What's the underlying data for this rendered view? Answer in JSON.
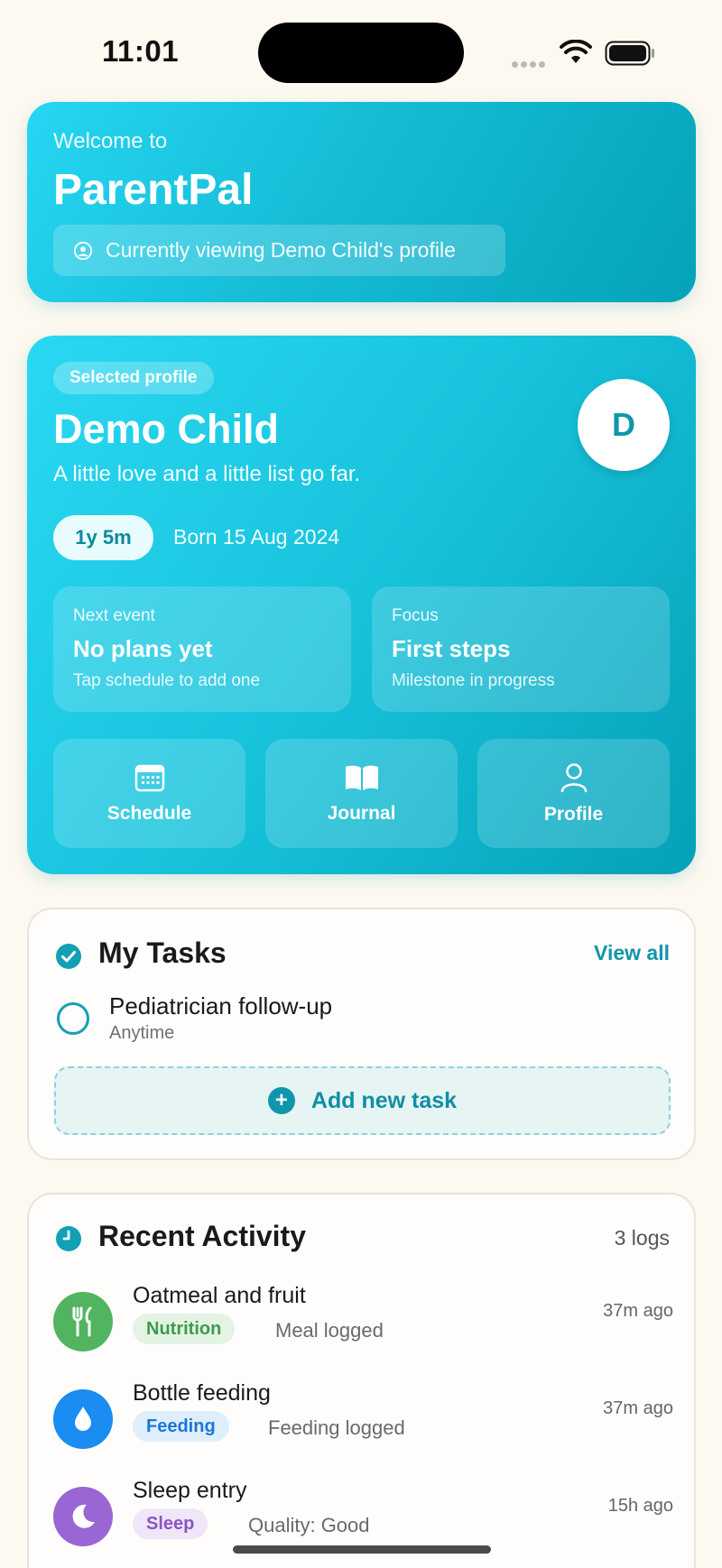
{
  "status_bar": {
    "time": "11:01"
  },
  "welcome": {
    "subtitle": "Welcome to",
    "app_name": "ParentPal",
    "viewing_text": "Currently viewing Demo Child's profile"
  },
  "profile": {
    "chip": "Selected profile",
    "name": "Demo Child",
    "tagline": "A little love and a little list go far.",
    "avatar_initial": "D",
    "age": "1y 5m",
    "born": "Born 15 Aug 2024",
    "next_event": {
      "label": "Next event",
      "value": "No plans yet",
      "hint": "Tap schedule to add one"
    },
    "focus": {
      "label": "Focus",
      "value": "First steps",
      "hint": "Milestone in progress"
    },
    "actions": [
      {
        "label": "Schedule",
        "icon": "calendar-icon"
      },
      {
        "label": "Journal",
        "icon": "book-icon"
      },
      {
        "label": "Profile",
        "icon": "person-icon"
      }
    ]
  },
  "tasks": {
    "title": "My Tasks",
    "view_all": "View all",
    "items": [
      {
        "title": "Pediatrician follow-up",
        "time": "Anytime"
      }
    ],
    "add_label": "Add new task"
  },
  "activity": {
    "title": "Recent Activity",
    "count": "3 logs",
    "items": [
      {
        "title": "Oatmeal and fruit",
        "tag": "Nutrition",
        "desc": "Meal logged",
        "time": "37m ago",
        "icon": "fork-knife-icon",
        "color": "#52b461",
        "tag_bg": "#e3f3e4",
        "tag_color": "#3f9b4d"
      },
      {
        "title": "Bottle feeding",
        "tag": "Feeding",
        "desc": "Feeding logged",
        "time": "37m ago",
        "icon": "drop-icon",
        "color": "#1a8cf2",
        "tag_bg": "#dfeefc",
        "tag_color": "#1a78d4"
      },
      {
        "title": "Sleep entry",
        "tag": "Sleep",
        "desc": "Quality: Good",
        "time": "15h ago",
        "icon": "moon-icon",
        "color": "#9a66d4",
        "tag_bg": "#efe6f8",
        "tag_color": "#8a55c6"
      }
    ]
  }
}
